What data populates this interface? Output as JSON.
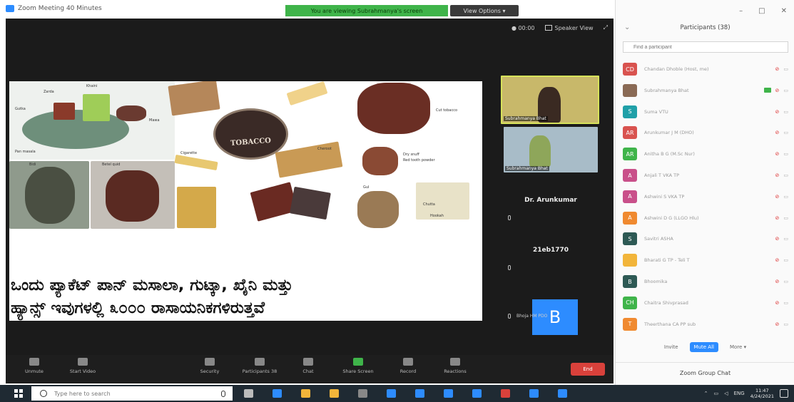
{
  "window": {
    "title": "Zoom Meeting 40 Minutes",
    "banner": "You are viewing Subrahmanya's screen",
    "view_options": "View Options ▾"
  },
  "meeting_top": {
    "recording": "● 00:00",
    "speaker_view": "Speaker View",
    "fullscreen_icon": "fullscreen-icon"
  },
  "slide": {
    "caption_line1": "ಒಂದು ಪ್ಯಾಕೆಟ್ ಪಾನ್ ಮಸಾಲಾ, ಗುಟ್ಕಾ, ಖೈನಿ ಮತ್ತು",
    "caption_line2": "ಹ್ಯಾನ್ಸ್ ಇವುಗಳಲ್ಲಿ ೩೦೦೦ ರಾಸಾಯನಿಕಗಳಿರುತ್ತವೆ",
    "tin_label": "TOBACCO",
    "tags": [
      "Zarda",
      "Khaini",
      "Gutka",
      "Pan masala",
      "Mawa",
      "Betel quid",
      "Bidi",
      "Cut tobacco",
      "Dry snuff",
      "Red tooth powder",
      "Gul",
      "Cigarette",
      "Cheroot",
      "Chutta",
      "Hookah"
    ]
  },
  "videos": {
    "tile1_name": "Subrahmanya Bhat",
    "tile2_name": "Subrahmanya Bhat",
    "tile3_name": "Dr. Arunkumar",
    "tile4_name": "21eb1770",
    "tile5_letter": "B",
    "tile5_name": "Bhoja HM PDO"
  },
  "toolbar": {
    "buttons": [
      "Unmute",
      "Start Video",
      "Security",
      "Participants",
      "Chat",
      "Share Screen",
      "Record",
      "Reactions"
    ],
    "participants_count": "38",
    "end": "End"
  },
  "panel": {
    "title": "Participants (38)",
    "find_placeholder": "Find a participant",
    "participants": [
      {
        "initial": "CD",
        "name": "Chandan Dhoble (Host, me)",
        "color": "#d9534f",
        "video_on": false
      },
      {
        "initial": "",
        "name": "Subrahmanya Bhat",
        "color": "#8a6a55",
        "video_on": true
      },
      {
        "initial": "S",
        "name": "Suma VTU",
        "color": "#20a0a8",
        "video_on": false
      },
      {
        "initial": "AR",
        "name": "Arunkumar J M (DHO)",
        "color": "#d9534f",
        "video_on": false
      },
      {
        "initial": "AR",
        "name": "Anitha B G (M.Sc Nur)",
        "color": "#3fb44a",
        "video_on": false
      },
      {
        "initial": "A",
        "name": "Anjali T VKA TP",
        "color": "#c9508a",
        "video_on": false
      },
      {
        "initial": "A",
        "name": "Ashwini S VKA TP",
        "color": "#c9508a",
        "video_on": false
      },
      {
        "initial": "A",
        "name": "Ashwini D G (LLGO Hlu)",
        "color": "#f08a30",
        "video_on": false
      },
      {
        "initial": "S",
        "name": "Savitri ASHA",
        "color": "#2e5a55",
        "video_on": false
      },
      {
        "initial": "",
        "name": "Bharati G TP - Teli T",
        "color": "#f2b53a",
        "video_on": false
      },
      {
        "initial": "B",
        "name": "Bhoomika",
        "color": "#2e5a55",
        "video_on": false
      },
      {
        "initial": "CH",
        "name": "Chaitra Shivprasad",
        "color": "#3fb44a",
        "video_on": false
      },
      {
        "initial": "T",
        "name": "Theerthana CA PP sub",
        "color": "#f08a30",
        "video_on": false
      }
    ],
    "actions": [
      "Invite",
      "Mute All",
      "More ▾"
    ],
    "group_chat": "Zoom Group Chat"
  },
  "taskbar": {
    "search_placeholder": "Type here to search",
    "time": "11:47",
    "date": "4/24/2021",
    "tray_text": "ENG",
    "icons": [
      "task-view-icon",
      "edge-icon",
      "store-icon",
      "file-explorer-icon",
      "calculator-icon",
      "teams-icon",
      "camera-icon",
      "word-icon",
      "zoom-taskbar-icon",
      "photos-icon",
      "mail-icon",
      "media-icon"
    ]
  },
  "colors": {
    "banner_green": "#3fb44a",
    "accent_blue": "#2d8cff",
    "end_red": "#d9413b",
    "meeting_bg": "#1b1b1b"
  }
}
